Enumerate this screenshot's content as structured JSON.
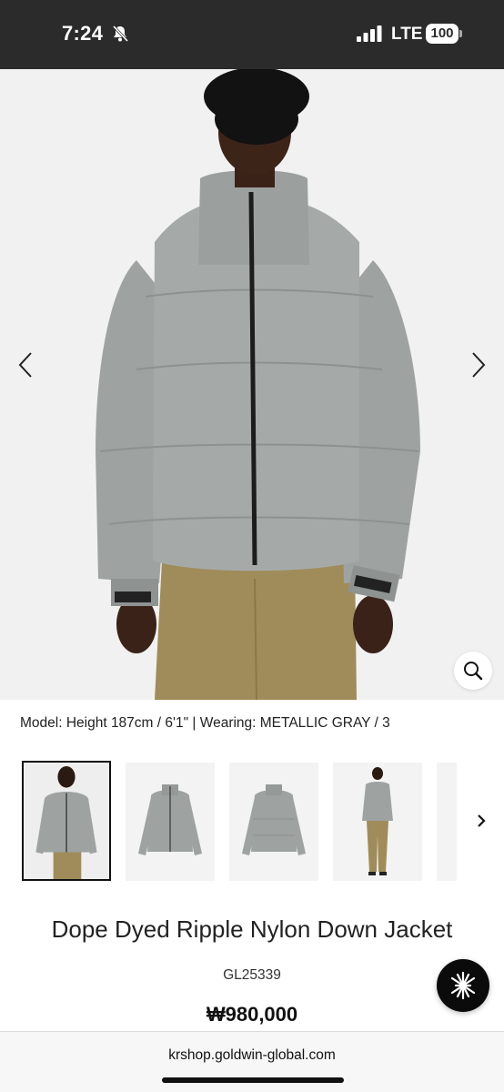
{
  "status_bar": {
    "time": "7:24",
    "network": "LTE",
    "battery": "100",
    "icons": [
      "bell-slash-icon",
      "signal-bars-icon",
      "battery-icon"
    ]
  },
  "hero": {
    "icons": [
      "chevron-left-icon",
      "chevron-right-icon",
      "magnifier-icon"
    ]
  },
  "caption": "Model: Height 187cm / 6'1\" | Wearing: METALLIC GRAY / 3",
  "thumbnails": {
    "count_visible": 5,
    "selected_index": 0,
    "icons": [
      "chevron-right-icon"
    ]
  },
  "product": {
    "title": "Dope Dyed Ripple Nylon Down Jacket",
    "code": "GL25339",
    "price": "₩980,000"
  },
  "browser": {
    "url": "krshop.goldwin-global.com"
  },
  "colors": {
    "status_bar": "#2b2b2b",
    "jacket": "#9ea3a2",
    "pants": "#a08c5a",
    "background": "#f1f1f1"
  }
}
